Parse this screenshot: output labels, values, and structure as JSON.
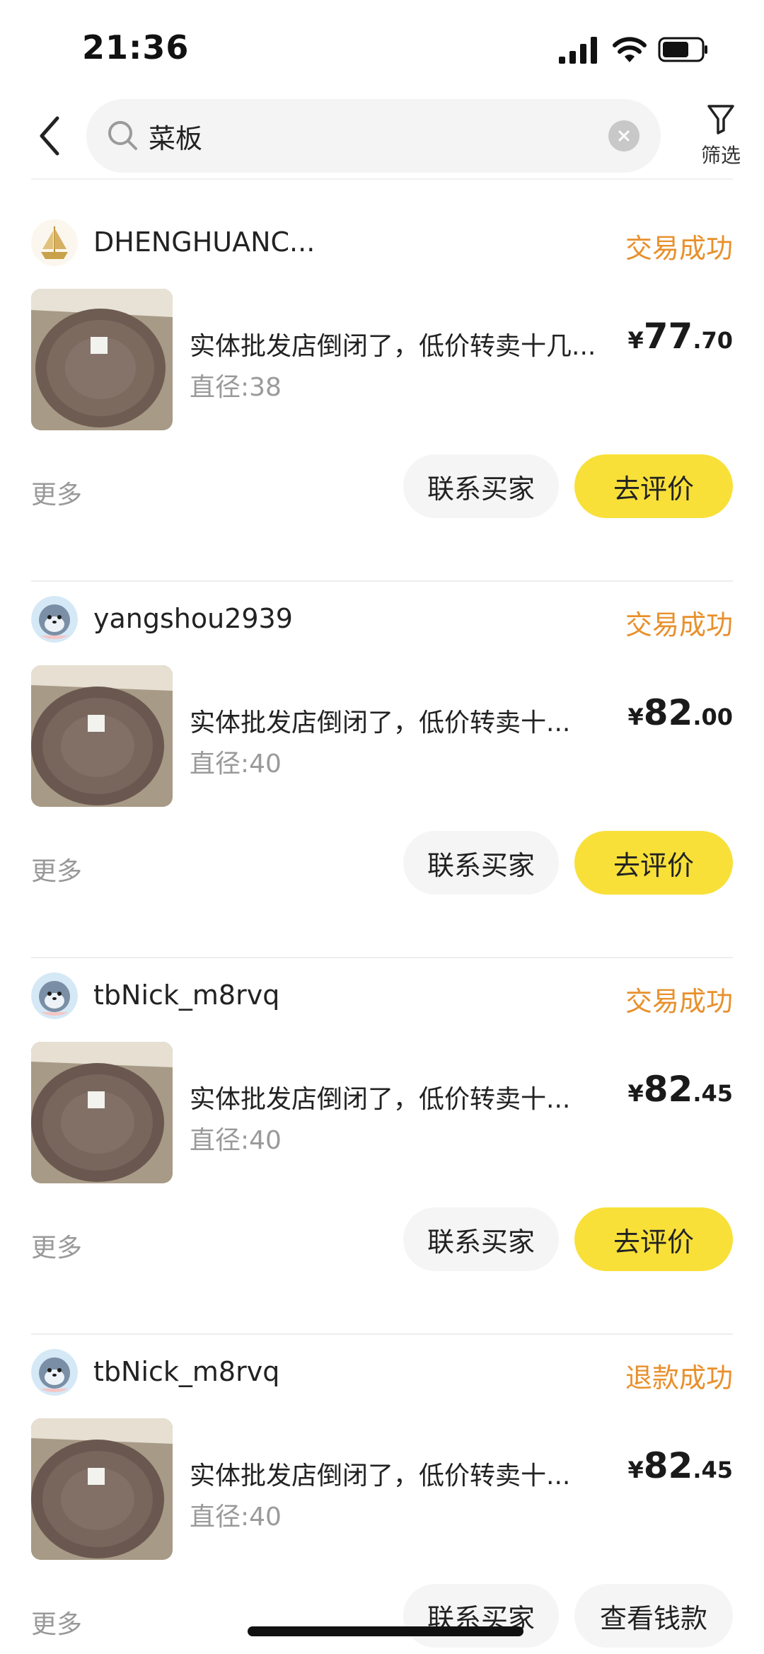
{
  "status_bar": {
    "time": "21:36"
  },
  "search": {
    "query": "菜板"
  },
  "filter": {
    "label": "筛选"
  },
  "orders": [
    {
      "user": "DHENGHUANC...",
      "status": "交易成功",
      "title": "实体批发店倒闭了，低价转卖十几...",
      "spec": "直径:38",
      "price_currency": "¥",
      "price_int": "77",
      "price_dec": ".70",
      "more": "更多",
      "contact": "联系买家",
      "action": "去评价"
    },
    {
      "user": "yangshou2939",
      "status": "交易成功",
      "title": "实体批发店倒闭了，低价转卖十...",
      "spec": "直径:40",
      "price_currency": "¥",
      "price_int": "82",
      "price_dec": ".00",
      "more": "更多",
      "contact": "联系买家",
      "action": "去评价"
    },
    {
      "user": "tbNick_m8rvq",
      "status": "交易成功",
      "title": "实体批发店倒闭了，低价转卖十...",
      "spec": "直径:40",
      "price_currency": "¥",
      "price_int": "82",
      "price_dec": ".45",
      "more": "更多",
      "contact": "联系买家",
      "action": "去评价"
    },
    {
      "user": "tbNick_m8rvq",
      "status": "退款成功",
      "title": "实体批发店倒闭了，低价转卖十...",
      "spec": "直径:40",
      "price_currency": "¥",
      "price_int": "82",
      "price_dec": ".45",
      "more": "更多",
      "contact": "联系买家",
      "action": "查看钱款"
    }
  ],
  "colors": {
    "accent_yellow": "#f8e039",
    "status_orange": "#e8902c"
  },
  "icons": [
    "back-arrow-icon",
    "search-icon",
    "clear-icon",
    "filter-funnel-icon",
    "signal-icon",
    "wifi-icon",
    "battery-icon"
  ]
}
